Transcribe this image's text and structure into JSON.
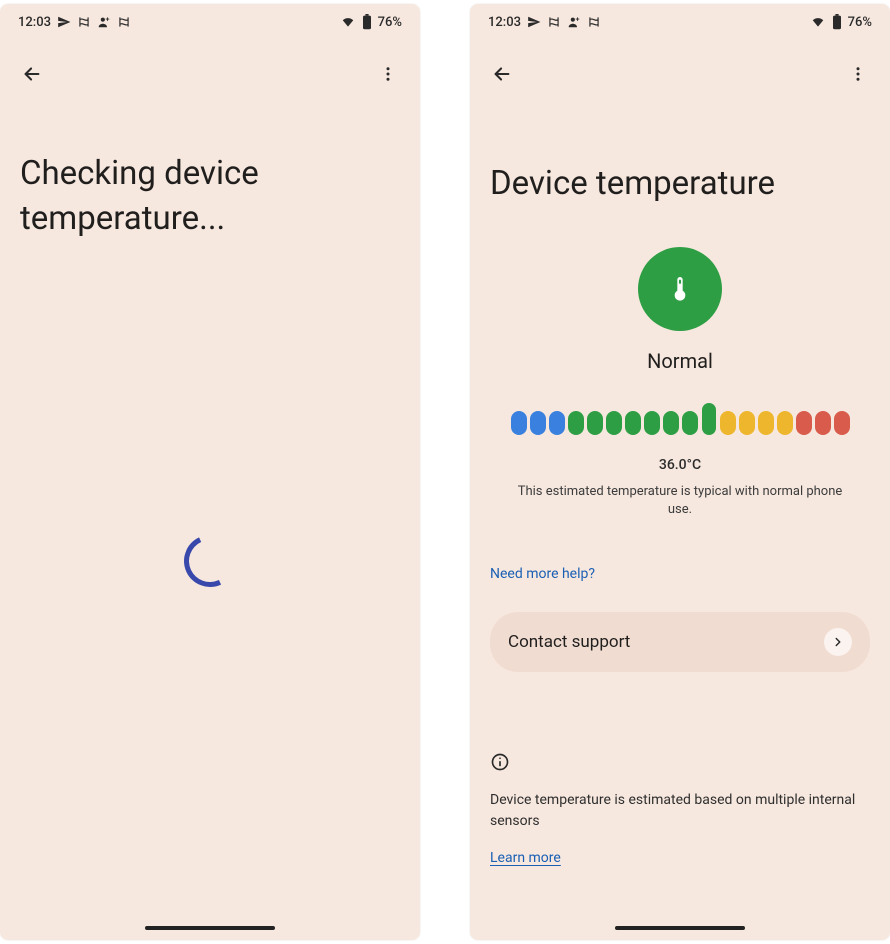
{
  "statusbar": {
    "time": "12:03",
    "battery": "76%"
  },
  "left_screen": {
    "title": "Checking device temperature..."
  },
  "right_screen": {
    "title": "Device temperature",
    "status_label": "Normal",
    "temp_value": "36.0°C",
    "temp_desc": "This estimated temperature is typical with normal phone use.",
    "help_link": "Need more help?",
    "contact_label": "Contact support",
    "info_text": "Device temperature is estimated based on multiple internal sensors",
    "learn_more": "Learn more",
    "meter": {
      "colors": [
        "blue",
        "blue",
        "blue",
        "green",
        "green",
        "green",
        "green",
        "green",
        "green",
        "green",
        "green",
        "yellow",
        "yellow",
        "yellow",
        "yellow",
        "red",
        "red",
        "red"
      ],
      "current_index": 10
    }
  }
}
